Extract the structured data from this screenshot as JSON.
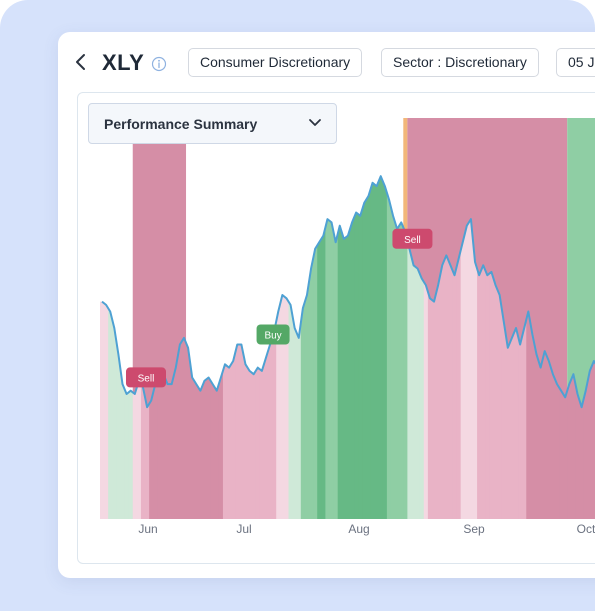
{
  "header": {
    "ticker": "XLY",
    "pills": [
      "Consumer Discretionary",
      "Sector : Discretionary",
      "05 J"
    ]
  },
  "chart_panel": {
    "view_selector": "Performance Summary"
  },
  "colors": {
    "line": "#4ea1d3",
    "strong_sell": "#d58ea6",
    "sell": "#e9b3c6",
    "weak_sell": "#f4d8e2",
    "strong_buy": "#66b985",
    "buy": "#8fcea4",
    "weak_buy": "#cfe9d8",
    "sell_badge": "#cd4a6e",
    "buy_badge": "#54a866",
    "orange_band": "#f2b77a"
  },
  "chart_data": {
    "type": "area",
    "months": [
      "Jun",
      "Jul",
      "Aug",
      "Sep",
      "Oct"
    ],
    "series": [
      {
        "values": [
          0.58,
          0.57,
          0.55,
          0.5,
          0.42,
          0.33,
          0.3,
          0.31,
          0.3,
          0.34,
          0.32,
          0.26,
          0.28,
          0.33,
          0.37,
          0.36,
          0.33,
          0.33,
          0.38,
          0.45,
          0.47,
          0.44,
          0.35,
          0.33,
          0.31,
          0.34,
          0.35,
          0.33,
          0.31,
          0.35,
          0.39,
          0.38,
          0.4,
          0.45,
          0.45,
          0.39,
          0.37,
          0.36,
          0.38,
          0.37,
          0.41,
          0.45,
          0.49,
          0.55,
          0.6,
          0.59,
          0.57,
          0.5,
          0.47,
          0.56,
          0.6,
          0.68,
          0.74,
          0.76,
          0.78,
          0.83,
          0.82,
          0.76,
          0.81,
          0.77,
          0.78,
          0.82,
          0.85,
          0.84,
          0.88,
          0.9,
          0.94,
          0.93,
          0.96,
          0.93,
          0.89,
          0.84,
          0.8,
          0.82,
          0.79,
          0.74,
          0.69,
          0.68,
          0.65,
          0.63,
          0.59,
          0.58,
          0.63,
          0.69,
          0.72,
          0.69,
          0.66,
          0.71,
          0.76,
          0.81,
          0.83,
          0.7,
          0.66,
          0.69,
          0.66,
          0.67,
          0.63,
          0.6,
          0.52,
          0.44,
          0.47,
          0.5,
          0.45,
          0.5,
          0.55,
          0.48,
          0.42,
          0.38,
          0.43,
          0.4,
          0.36,
          0.33,
          0.31,
          0.29,
          0.33,
          0.36,
          0.3,
          0.26,
          0.31,
          0.37,
          0.4,
          0.38
        ]
      }
    ],
    "ylim": [
      0,
      1
    ],
    "regimes": [
      "weak_sell",
      "weak_sell",
      "weak_buy",
      "weak_buy",
      "weak_buy",
      "weak_buy",
      "weak_buy",
      "weak_buy",
      "weak_sell",
      "weak_sell",
      "sell",
      "sell",
      "strong_sell",
      "strong_sell",
      "strong_sell",
      "strong_sell",
      "strong_sell",
      "strong_sell",
      "strong_sell",
      "strong_sell",
      "strong_sell",
      "strong_sell",
      "strong_sell",
      "strong_sell",
      "strong_sell",
      "strong_sell",
      "strong_sell",
      "strong_sell",
      "strong_sell",
      "strong_sell",
      "sell",
      "sell",
      "sell",
      "sell",
      "sell",
      "sell",
      "sell",
      "sell",
      "sell",
      "sell",
      "sell",
      "sell",
      "sell",
      "weak_sell",
      "weak_sell",
      "weak_sell",
      "weak_buy",
      "weak_buy",
      "weak_buy",
      "buy",
      "buy",
      "buy",
      "buy",
      "strong_buy",
      "strong_buy",
      "buy",
      "buy",
      "buy",
      "strong_buy",
      "strong_buy",
      "strong_buy",
      "strong_buy",
      "strong_buy",
      "strong_buy",
      "strong_buy",
      "strong_buy",
      "strong_buy",
      "strong_buy",
      "strong_buy",
      "strong_buy",
      "buy",
      "buy",
      "buy",
      "buy",
      "buy",
      "weak_buy",
      "weak_buy",
      "weak_buy",
      "weak_buy",
      "weak_sell",
      "sell",
      "sell",
      "sell",
      "sell",
      "sell",
      "sell",
      "sell",
      "sell",
      "weak_sell",
      "weak_sell",
      "weak_sell",
      "weak_sell",
      "sell",
      "sell",
      "sell",
      "sell",
      "sell",
      "sell",
      "sell",
      "sell",
      "sell",
      "sell",
      "sell",
      "sell",
      "strong_sell",
      "strong_sell",
      "strong_sell",
      "strong_sell",
      "strong_sell",
      "strong_sell",
      "strong_sell",
      "strong_sell",
      "strong_sell",
      "strong_sell",
      "strong_sell",
      "strong_sell",
      "strong_sell",
      "strong_sell",
      "strong_sell",
      "strong_sell",
      "strong_sell",
      "strong_sell"
    ],
    "bands": [
      {
        "regime": "strong_sell",
        "from": 8,
        "to": 21
      },
      {
        "regime": "orange_band",
        "from": 74,
        "to": 75
      },
      {
        "regime": "strong_sell",
        "from": 75,
        "to": 114
      },
      {
        "regime": "buy",
        "from": 114,
        "to": 122
      }
    ],
    "signals": [
      {
        "label": "Sell",
        "type": "sell",
        "index": 10
      },
      {
        "label": "Buy",
        "type": "buy",
        "index": 41
      },
      {
        "label": "Sell",
        "type": "sell",
        "index": 75
      }
    ]
  }
}
